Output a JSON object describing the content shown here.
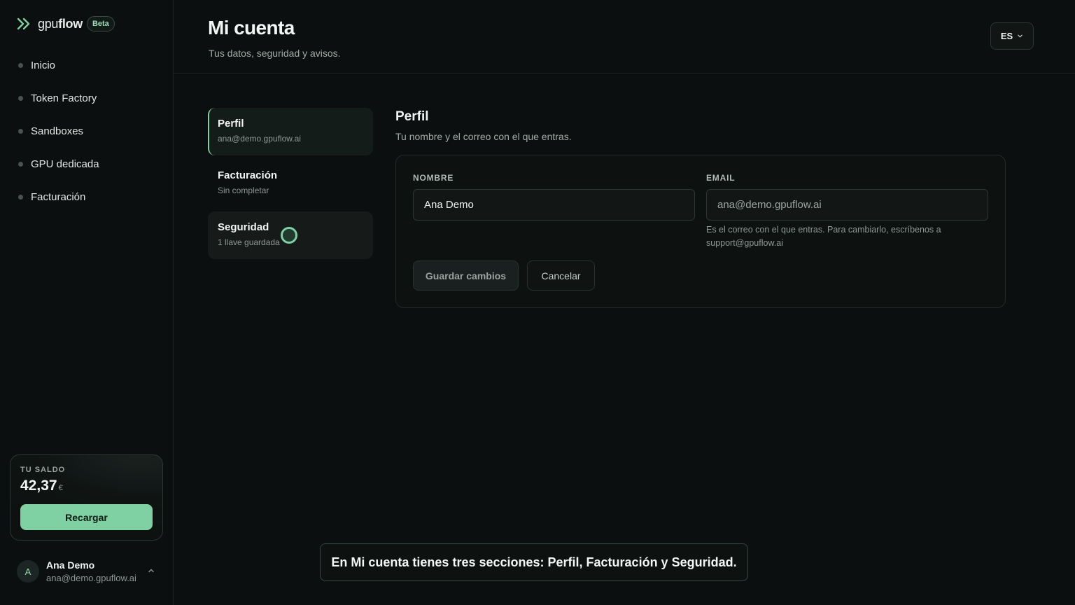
{
  "brand": {
    "name_light": "gpu",
    "name_bold": "flow",
    "badge": "Beta"
  },
  "sidebar": {
    "items": [
      {
        "label": "Inicio"
      },
      {
        "label": "Token Factory"
      },
      {
        "label": "Sandboxes"
      },
      {
        "label": "GPU dedicada"
      },
      {
        "label": "Facturación"
      }
    ],
    "balance": {
      "title": "TU SALDO",
      "amount": "42,37",
      "currency": "€",
      "button": "Recargar"
    },
    "user": {
      "initial": "A",
      "name": "Ana Demo",
      "email": "ana@demo.gpuflow.ai"
    }
  },
  "header": {
    "title": "Mi cuenta",
    "subtitle": "Tus datos, seguridad y avisos.",
    "language": "ES"
  },
  "tabs": [
    {
      "title": "Perfil",
      "subtitle": "ana@demo.gpuflow.ai",
      "state": "active"
    },
    {
      "title": "Facturación",
      "subtitle": "Sin completar",
      "state": "default"
    },
    {
      "title": "Seguridad",
      "subtitle": "1 llave guardada",
      "state": "hover"
    }
  ],
  "profile": {
    "title": "Perfil",
    "subtitle": "Tu nombre y el correo con el que entras.",
    "name_label": "NOMBRE",
    "name_value": "Ana Demo",
    "email_label": "EMAIL",
    "email_value": "ana@demo.gpuflow.ai",
    "email_help": "Es el correo con el que entras. Para cambiarlo, escríbenos a support@gpuflow.ai",
    "save_label": "Guardar cambios",
    "cancel_label": "Cancelar"
  },
  "caption": "En Mi cuenta tienes tres secciones: Perfil, Facturación y Seguridad.",
  "colors": {
    "accent": "#7fd0a2",
    "background": "#0b0f0f"
  }
}
